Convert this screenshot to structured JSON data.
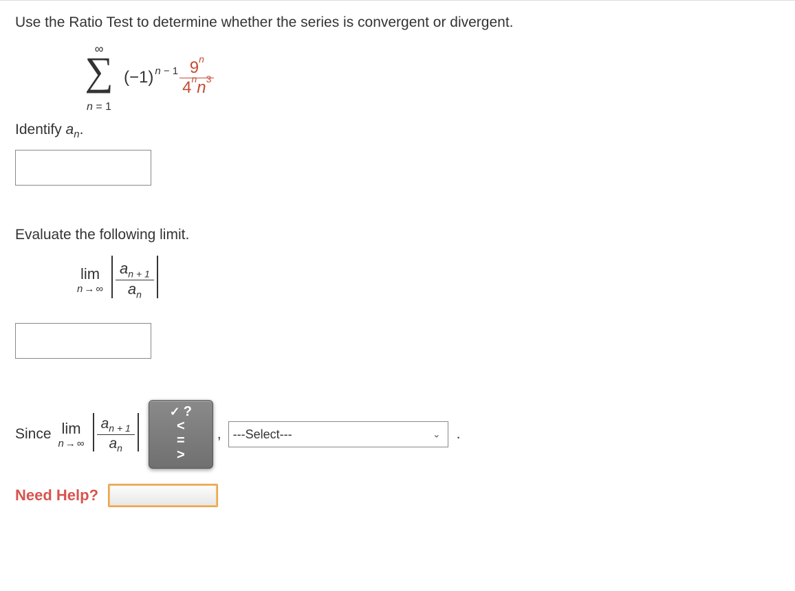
{
  "instruction": "Use the Ratio Test to determine whether the series is convergent or divergent.",
  "series": {
    "sigma_upper": "∞",
    "sigma_lower_var": "n",
    "sigma_lower_eq": "= 1",
    "neg1_base": "(−1)",
    "neg1_exp_var": "n",
    "neg1_exp_rest": " − 1",
    "frac_num_base": "9",
    "frac_num_exp": "n",
    "frac_den_b1": "4",
    "frac_den_e1": "n",
    "frac_den_b2": "n",
    "frac_den_e2": "3"
  },
  "identify_label_pre": "Identify ",
  "identify_a": "a",
  "identify_sub": "n",
  "identify_label_post": ".",
  "input1_value": "",
  "eval_label": "Evaluate the following limit.",
  "limit": {
    "lim_text": "lim",
    "cond_var": "n",
    "cond_arrow": "→",
    "cond_inf": "∞",
    "num_a": "a",
    "num_sub": "n + 1",
    "den_a": "a",
    "den_sub": "n"
  },
  "input2_value": "",
  "since_label": "Since",
  "dropdown_options": {
    "opt0": "?",
    "opt1": "<",
    "opt2": "=",
    "opt3": ">"
  },
  "dropdown_selected": "?",
  "comma": ",",
  "select_placeholder": "---Select---",
  "period": ".",
  "need_help_label": "Need Help?",
  "help_button_label": ""
}
